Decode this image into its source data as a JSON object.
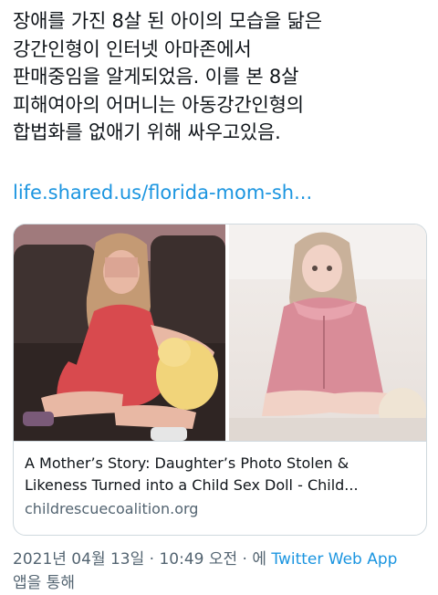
{
  "tweet": {
    "text_lines": [
      "장애를 가진 8살 된 아이의 모습을 닮은",
      "강간인형이 인터넷 아마존에서",
      "판매중임을 알게되었음. 이를 본 8살",
      "피해여아의 어머니는 아동강간인형의",
      "합법화를 없애기 위해 싸우고있음."
    ],
    "link_text": "life.shared.us/florida-mom-sh..."
  },
  "card": {
    "title_lines": [
      "A Mother’s Story: Daughter’s Photo Stolen &",
      "Likeness Turned into a Child Sex Doll - Child..."
    ],
    "domain": "childrescuecoalition.org"
  },
  "meta": {
    "timestamp": "2021년 04월 13일 · 10:49 오전 · 에",
    "source": "Twitter Web App",
    "suffix": "앱을 통해"
  },
  "colors": {
    "link": "#1b95e0",
    "secondary_text": "#536471",
    "border": "#cfd9de"
  }
}
